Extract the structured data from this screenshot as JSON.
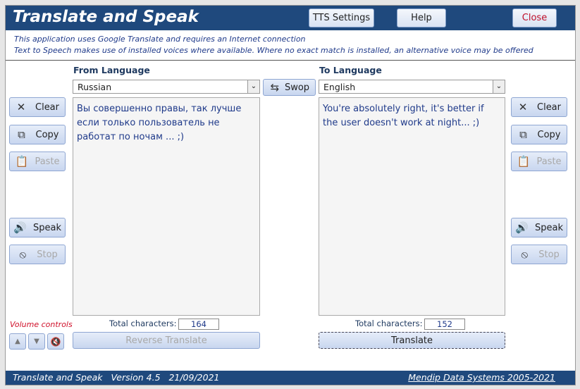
{
  "header": {
    "title": "Translate and Speak",
    "tts_settings": "TTS Settings",
    "help": "Help",
    "close": "Close"
  },
  "info": [
    "This application uses Google Translate and requires an Internet connection",
    "Text to Speech makes use of installed voices where available. Where no exact match is installed, an alternative voice may be offered"
  ],
  "from": {
    "label": "From Language",
    "language": "Russian",
    "text": "Вы совершенно правы, так лучше если только пользователь не работат  по ночам ... ;)",
    "count_label": "Total characters:",
    "count": "164",
    "action": "Reverse Translate"
  },
  "to": {
    "label": "To Language",
    "language": "English",
    "text": "You're absolutely right, it's better if the user doesn't work at night... ;)",
    "count_label": "Total characters:",
    "count": "152",
    "action": "Translate"
  },
  "swop": "Swop",
  "buttons": {
    "clear": "Clear",
    "copy": "Copy",
    "paste": "Paste",
    "speak": "Speak",
    "stop": "Stop"
  },
  "volume_label": "Volume controls",
  "footer": {
    "left": "Translate and Speak   Version 4.5   21/09/2021",
    "right": "Mendip Data Systems 2005-2021"
  }
}
